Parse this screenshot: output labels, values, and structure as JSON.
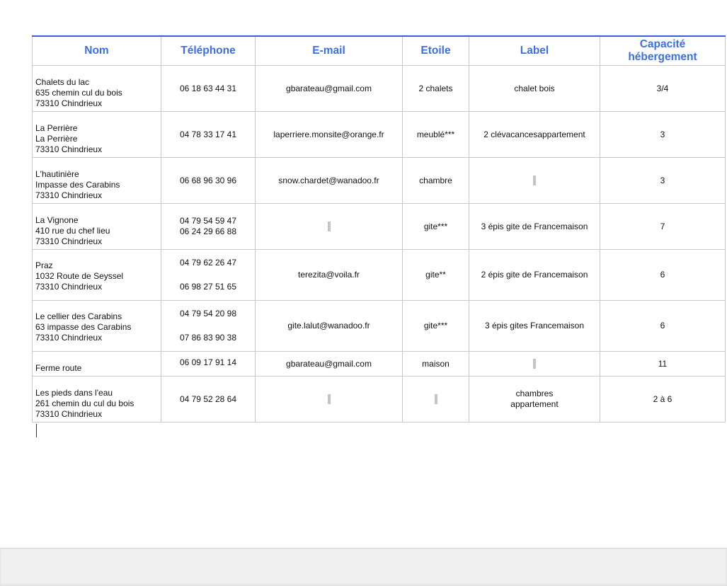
{
  "table": {
    "headers": [
      "Nom",
      "Téléphone",
      "E-mail",
      "Etoile",
      "Label",
      "Capacité hébergement"
    ],
    "header_capacity_lines": [
      "Capacité",
      "hébergement"
    ],
    "rows": [
      {
        "nom": [
          "Chalets du lac",
          "635 chemin cul du bois",
          "73310 Chindrieux"
        ],
        "telephone": [
          "06 18 63 44 31"
        ],
        "email": "gbarateau@gmail.com",
        "etoile": "2 chalets",
        "label": [
          "chalet bois"
        ],
        "capacite": "3/4"
      },
      {
        "nom": [
          "La Perrière",
          "La Perrière",
          "73310 Chindrieux"
        ],
        "telephone": [
          "04 78 33 17 41"
        ],
        "email": "laperriere.monsite@orange.fr",
        "etoile": "meublé***",
        "label": [
          "2 clévacancesappartement"
        ],
        "capacite": "3"
      },
      {
        "nom": [
          "L'hautinière",
          "Impasse des Carabins",
          "73310 Chindrieux"
        ],
        "telephone": [
          "06 68 96 30 96"
        ],
        "email": "snow.chardet@wanadoo.fr",
        "etoile": "chambre",
        "label": [],
        "capacite": "3"
      },
      {
        "nom": [
          "La Vignone",
          "410 rue du chef lieu",
          "73310 Chindrieux"
        ],
        "telephone": [
          "04 79 54 59 47",
          "06 24 29 66 88"
        ],
        "email": "",
        "etoile": "gite***",
        "label": [
          "3 épis gite de Francemaison"
        ],
        "capacite": "7"
      },
      {
        "nom": [
          "Praz",
          "1032 Route de Seyssel",
          "73310 Chindrieux"
        ],
        "telephone_split": [
          "04 79 62 26 47",
          "06 98 27 51 65"
        ],
        "email": "terezita@voila.fr",
        "etoile": "gite**",
        "label": [
          "2 épis gite de Francemaison"
        ],
        "capacite": "6"
      },
      {
        "nom": [
          "Le cellier des Carabins",
          "63 impasse des Carabins",
          "73310 Chindrieux"
        ],
        "telephone_split": [
          "04 79 54 20 98",
          "07 86 83 90 38"
        ],
        "email": "gite.lalut@wanadoo.fr",
        "etoile": "gite***",
        "label": [
          "3 épis gites Francemaison"
        ],
        "capacite": "6"
      },
      {
        "nom": [
          "Ferme route"
        ],
        "telephone_top": "06 09 17 91 14",
        "email": "gbarateau@gmail.com",
        "etoile": "maison",
        "label": [],
        "capacite": "11"
      },
      {
        "nom": [
          "Les pieds dans l'eau",
          "261 chemin du cul du bois",
          "73310 Chindrieux"
        ],
        "telephone": [
          "04 79 52 28 64"
        ],
        "email": "",
        "etoile": "",
        "label": [
          "chambres",
          "appartement"
        ],
        "capacite": "2 à 6"
      }
    ]
  }
}
